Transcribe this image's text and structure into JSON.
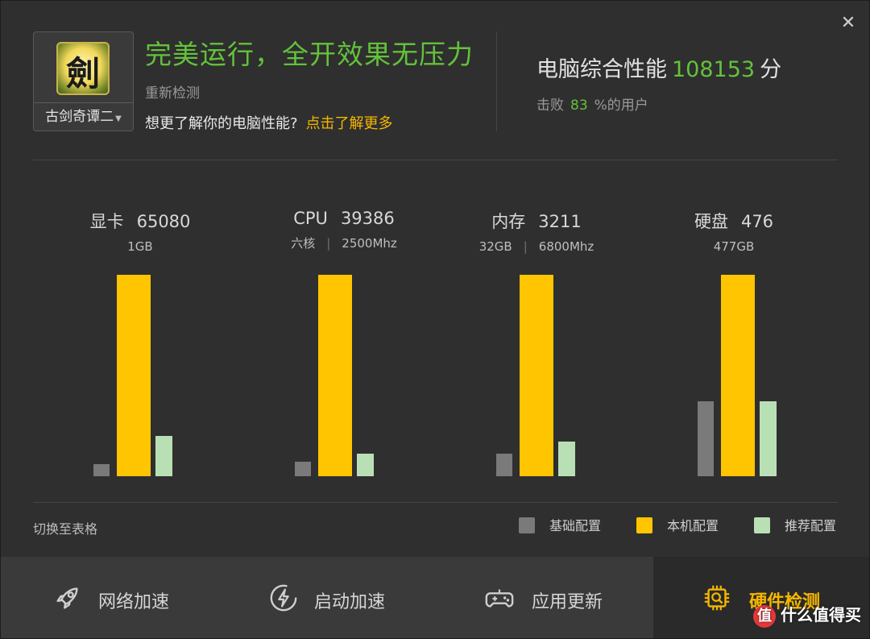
{
  "header": {
    "close_glyph": "✕",
    "game_icon_glyph": "劍",
    "game_name": "古剑奇谭二",
    "status_title": "完美运行，全开效果无压力",
    "recheck_label": "重新检测",
    "learn_text": "想更了解你的电脑性能?",
    "learn_link": "点击了解更多",
    "score_label": "电脑综合性能",
    "score_value": "108153",
    "score_unit": "分",
    "beat_prefix": "击败",
    "beat_value": "83",
    "beat_suffix": "%的用户"
  },
  "components": [
    {
      "name": "显卡",
      "score": "65080",
      "spec1": "1GB",
      "spec2": ""
    },
    {
      "name": "CPU",
      "score": "39386",
      "spec1": "六核",
      "spec2": "2500Mhz"
    },
    {
      "name": "内存",
      "score": "3211",
      "spec1": "32GB",
      "spec2": "6800Mhz"
    },
    {
      "name": "硬盘",
      "score": "476",
      "spec1": "477GB",
      "spec2": ""
    }
  ],
  "chart_data": {
    "type": "bar",
    "categories": [
      "显卡",
      "CPU",
      "内存",
      "硬盘"
    ],
    "series": [
      {
        "name": "基础配置",
        "values": [
          6,
          7,
          11,
          37
        ]
      },
      {
        "name": "本机配置",
        "values": [
          100,
          100,
          100,
          100
        ]
      },
      {
        "name": "推荐配置",
        "values": [
          20,
          11,
          17,
          37
        ]
      }
    ],
    "colors": {
      "base": "#7a7a7a",
      "mine": "#ffc500",
      "rec": "#b9e0b5"
    },
    "ylim": [
      0,
      100
    ],
    "legend_position": "bottom-right"
  },
  "footer": {
    "toggle_table_label": "切换至表格",
    "legend": [
      "基础配置",
      "本机配置",
      "推荐配置"
    ]
  },
  "nav": [
    {
      "label": "网络加速",
      "icon": "rocket-icon"
    },
    {
      "label": "启动加速",
      "icon": "lightning-icon"
    },
    {
      "label": "应用更新",
      "icon": "gamepad-icon"
    },
    {
      "label": "硬件检测",
      "icon": "chip-icon",
      "active": true
    }
  ],
  "watermark": {
    "badge": "值",
    "text": "什么值得买"
  }
}
